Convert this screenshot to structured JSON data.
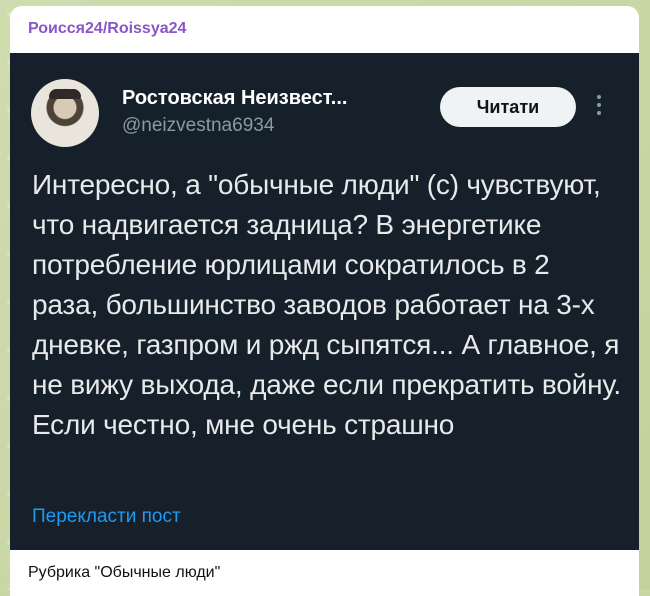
{
  "message": {
    "channel_name": "Роисся24/Roissya24",
    "caption": "Рубрика \"Обычные люди\""
  },
  "tweet": {
    "author_name": "Ростовская Неизвест...",
    "author_handle": "@neizvestna6934",
    "read_button": "Читати",
    "more_icon": "more-vertical-icon",
    "text": "Интересно, а \"обычные люди\" (с) чувствуют, что надвигается задница? В энергетике потребление юрлицами сократилось в 2 раза, большинство заводов работает на 3-х дневке, газпром и ржд сыпятся... А главное, я не вижу выхода, даже если прекратить войну. Если честно, мне очень страшно",
    "translate_link": "Перекласти пост"
  },
  "colors": {
    "channel_name": "#8a55c8",
    "tweet_background": "#15202b",
    "tweet_text": "#e7e9ea",
    "secondary_text": "#8b98a5",
    "link": "#1d9bf0",
    "button_background": "#eff3f4"
  }
}
